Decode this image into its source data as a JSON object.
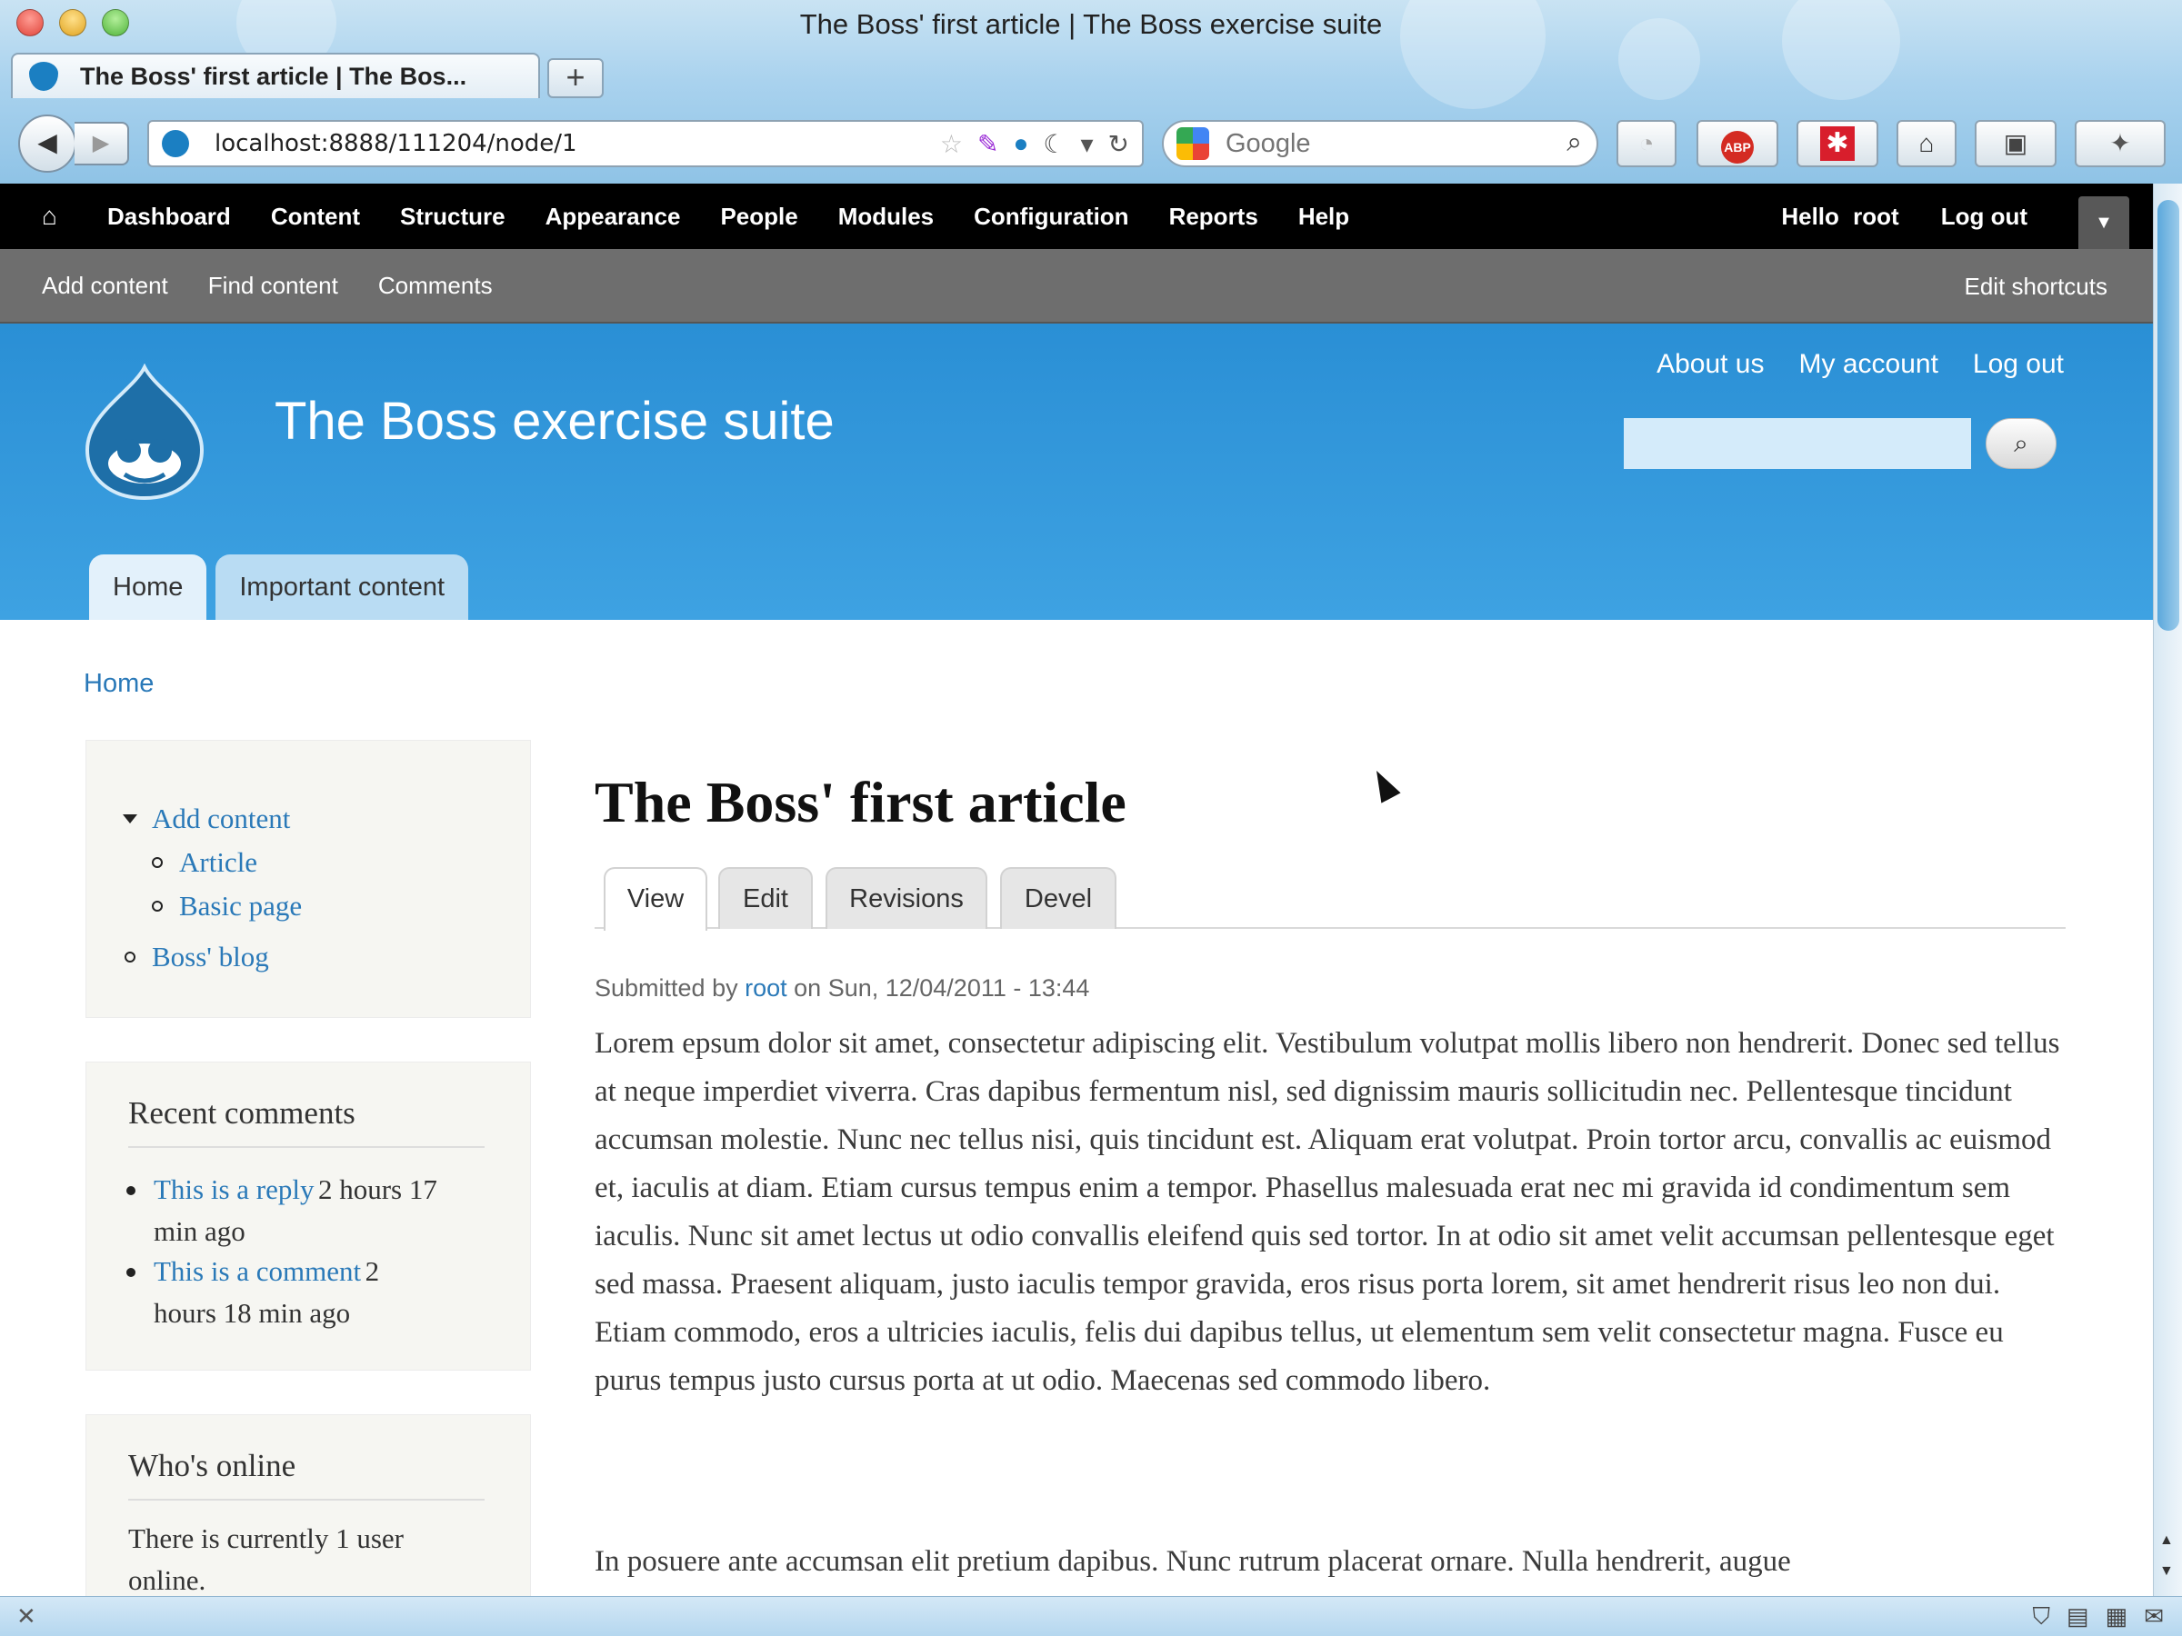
{
  "browser": {
    "window_title": "The Boss' first article | The Boss exercise suite",
    "tab_title": "The Boss' first article | The Bos...",
    "new_tab_symbol": "+",
    "url": "localhost:8888/111204/node/1",
    "search_placeholder": "Google"
  },
  "admin_toolbar": {
    "items": [
      "Dashboard",
      "Content",
      "Structure",
      "Appearance",
      "People",
      "Modules",
      "Configuration",
      "Reports",
      "Help"
    ],
    "hello_prefix": "Hello",
    "username": "root",
    "logout": "Log out"
  },
  "shortcuts": {
    "items": [
      "Add content",
      "Find content",
      "Comments"
    ],
    "edit": "Edit shortcuts"
  },
  "header": {
    "site_name": "The Boss exercise suite",
    "secondary_menu": [
      "About us",
      "My account",
      "Log out"
    ],
    "main_menu": [
      "Home",
      "Important content"
    ]
  },
  "breadcrumb": "Home",
  "sidebar": {
    "navigation": {
      "parent": "Add content",
      "children": [
        "Article",
        "Basic page"
      ],
      "other": "Boss' blog"
    },
    "recent_comments": {
      "title": "Recent comments",
      "items": [
        {
          "link": "This is a reply",
          "time_part1": "2 hours 17",
          "time_part2": "min ago"
        },
        {
          "link": "This is a comment",
          "time_part1": "2",
          "time_part2": "hours 18 min ago"
        }
      ]
    },
    "whos_online": {
      "title": "Who's online",
      "text_line1": "There is currently 1 user",
      "text_line2": "online."
    }
  },
  "article": {
    "title": "The Boss' first article",
    "tabs": [
      "View",
      "Edit",
      "Revisions",
      "Devel"
    ],
    "submitted_prefix": "Submitted by",
    "author": "root",
    "submitted_suffix": "on Sun, 12/04/2011 - 13:44",
    "paragraphs": [
      "Lorem epsum dolor sit amet, consectetur adipiscing elit. Vestibulum volutpat mollis libero non hendrerit. Donec sed tellus at neque imperdiet viverra. Cras dapibus fermentum nisl, sed dignissim mauris sollicitudin nec. Pellentesque tincidunt accumsan molestie. Nunc nec tellus nisi, quis tincidunt est. Aliquam erat volutpat. Proin tortor arcu, convallis ac euismod et, iaculis at diam. Etiam cursus tempus enim a tempor. Phasellus malesuada erat nec mi gravida id condimentum sem iaculis. Nunc sit amet lectus ut odio convallis eleifend quis sed tortor. In at odio sit amet velit accumsan pellentesque eget sed massa. Praesent aliquam, justo iaculis tempor gravida, eros risus porta lorem, sit amet hendrerit risus leo non dui. Etiam commodo, eros a ultricies iaculis, felis dui dapibus tellus, ut elementum sem velit consectetur magna. Fusce eu purus tempus justo cursus porta at ut odio. Maecenas sed commodo libero.",
      "In posuere ante accumsan elit pretium dapibus. Nunc rutrum placerat ornare. Nulla hendrerit, augue"
    ]
  },
  "colors": {
    "header_blue": "#3ea2e2",
    "link_blue": "#2a79b8",
    "admin_black": "#000000",
    "shortcut_gray": "#6e6e6e",
    "sidebar_bg": "#f6f6f2"
  },
  "icons": {
    "admin_home": "home-icon",
    "search": "search-icon",
    "nav_back": "back-arrow-icon",
    "nav_forward": "forward-arrow-icon",
    "reload": "reload-icon"
  }
}
